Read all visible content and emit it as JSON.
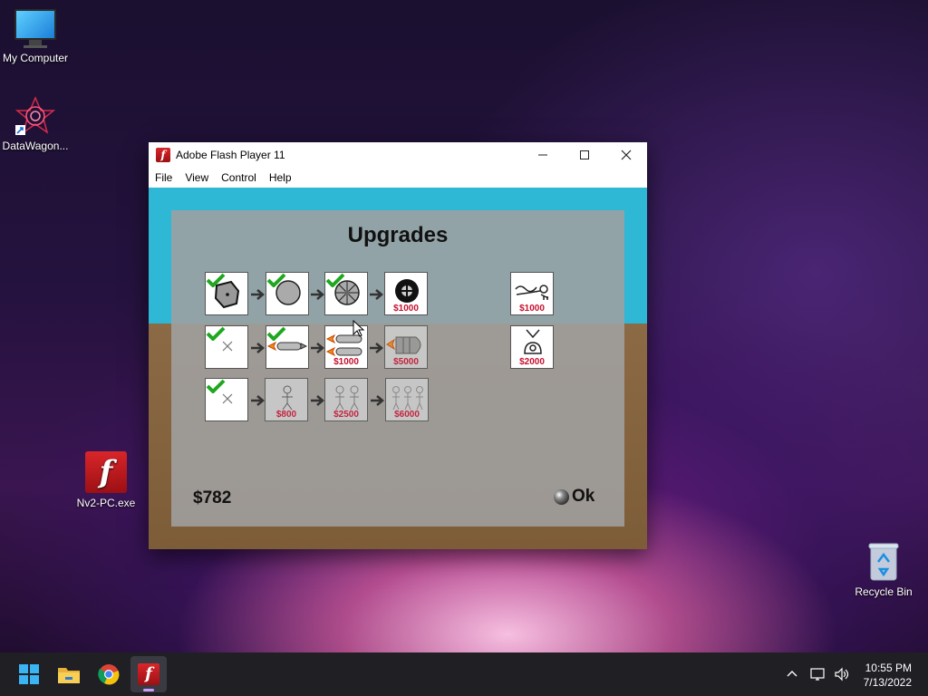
{
  "desktop": {
    "icons": [
      {
        "label": "My Computer"
      },
      {
        "label": "DataWagon..."
      },
      {
        "label": "Nv2-PC.exe"
      },
      {
        "label": "Recycle Bin"
      }
    ]
  },
  "window": {
    "title": "Adobe Flash Player 11",
    "controls": {
      "minimize": "—",
      "maximize": "☐",
      "close": "✕"
    },
    "menu": [
      "File",
      "View",
      "Control",
      "Help"
    ]
  },
  "game": {
    "title": "Upgrades",
    "money": "$782",
    "ok_label": "Ok",
    "rows": [
      [
        {
          "icon": "rock-wheel-icon",
          "state": "owned",
          "price": ""
        },
        {
          "icon": "round-wheel-icon",
          "state": "owned",
          "price": ""
        },
        {
          "icon": "spoked-wheel-icon",
          "state": "owned",
          "price": ""
        },
        {
          "icon": "tire-wheel-icon",
          "state": "available",
          "price": "$1000"
        }
      ],
      [
        {
          "icon": "none-icon",
          "state": "owned",
          "price": ""
        },
        {
          "icon": "single-rocket-icon",
          "state": "owned",
          "price": ""
        },
        {
          "icon": "double-rocket-icon",
          "state": "available",
          "price": "$1000"
        },
        {
          "icon": "big-rocket-icon",
          "state": "locked",
          "price": "$5000"
        }
      ],
      [
        {
          "icon": "none-icon",
          "state": "owned",
          "price": ""
        },
        {
          "icon": "one-passenger-icon",
          "state": "locked",
          "price": "$800"
        },
        {
          "icon": "two-passengers-icon",
          "state": "locked",
          "price": "$2500"
        },
        {
          "icon": "three-passengers-icon",
          "state": "locked",
          "price": "$6000"
        }
      ]
    ],
    "extras": [
      {
        "icon": "key-launcher-icon",
        "price": "$1000"
      },
      {
        "icon": "magnet-icon",
        "price": "$2000"
      }
    ]
  },
  "taskbar": {
    "apps": [
      "start-button",
      "file-explorer",
      "chrome",
      "flash-player"
    ],
    "clock": {
      "time": "10:55 PM",
      "date": "7/13/2022"
    }
  }
}
